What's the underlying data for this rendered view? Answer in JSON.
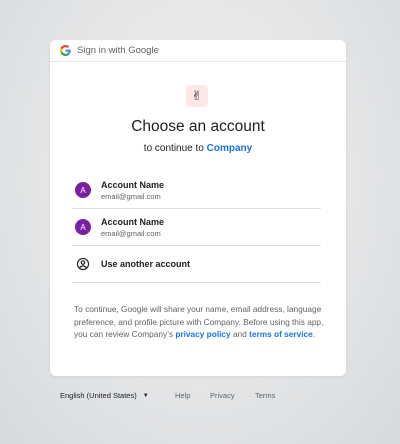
{
  "header": {
    "text": "Sign in with Google",
    "icon": "google-g-icon"
  },
  "app": {
    "logo_glyph": "✌"
  },
  "title": "Choose an account",
  "subtitle": {
    "prefix": "to continue to",
    "company": "Company"
  },
  "accounts": [
    {
      "initial": "A",
      "name": "Account Name",
      "email": "email@gmail.com"
    },
    {
      "initial": "A",
      "name": "Account Name",
      "email": "email@gmail.com"
    }
  ],
  "use_another": {
    "label": "Use another account",
    "icon": "account-circle-icon"
  },
  "disclaimer": {
    "text": "To continue, Google will share your name, email address, language preference, and profile picture with Company. Before using this app, you can review Company’s",
    "privacy_label": "privacy policy",
    "and": "and",
    "terms_label": "terms of service",
    "end": "."
  },
  "footer": {
    "language": "English (United States)",
    "help": "Help",
    "privacy": "Privacy",
    "terms": "Terms"
  },
  "colors": {
    "accent": "#1a73e8",
    "avatar": "#7b1fa2"
  }
}
